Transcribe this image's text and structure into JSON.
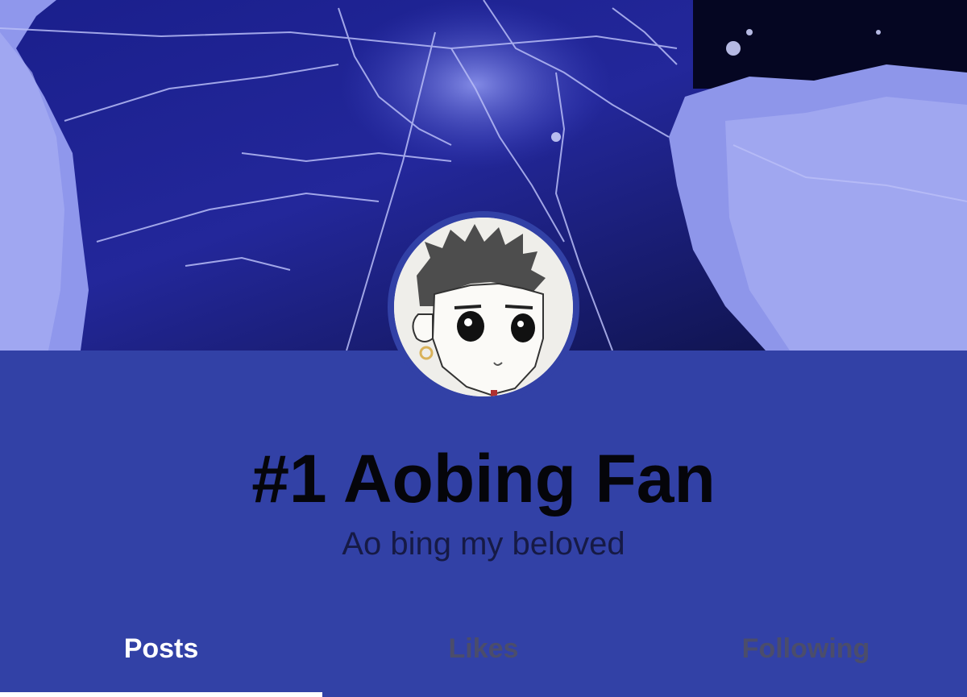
{
  "profile": {
    "title": "#1 Aobing Fan",
    "description": "Ao bing my beloved"
  },
  "tabs": [
    {
      "label": "Posts",
      "active": true
    },
    {
      "label": "Likes",
      "active": false
    },
    {
      "label": "Following",
      "active": false
    }
  ],
  "colors": {
    "panel_background": "#3241a6",
    "title_text": "#05050a",
    "description_text": "#161a45",
    "active_tab_text": "#ffffff",
    "inactive_tab_text": "#4b4d6b",
    "active_tab_indicator": "#ffffff"
  }
}
